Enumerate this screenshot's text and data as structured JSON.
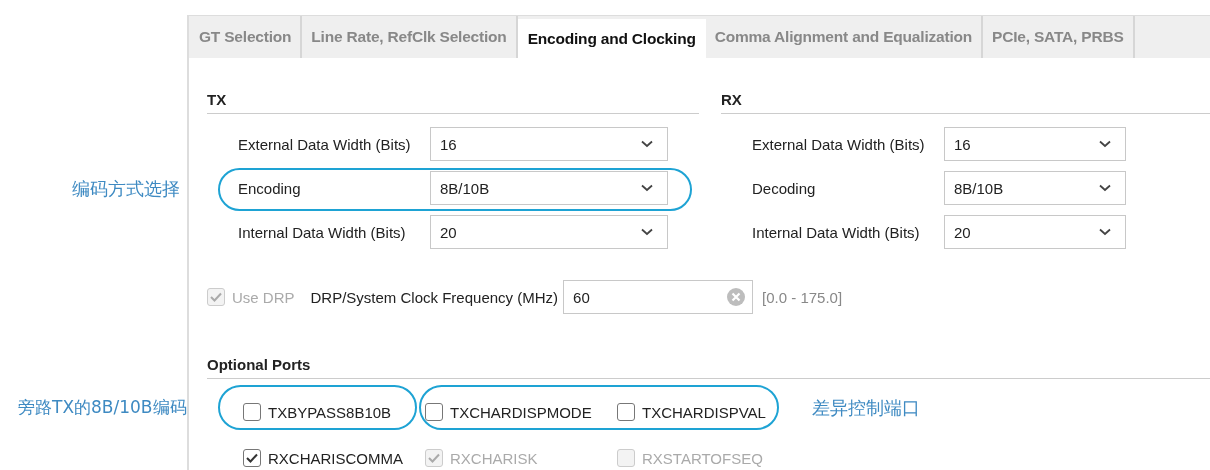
{
  "tabs": [
    {
      "label": "GT Selection",
      "selected": false
    },
    {
      "label": "Line Rate, RefClk Selection",
      "selected": false
    },
    {
      "label": "Encoding and Clocking",
      "selected": true
    },
    {
      "label": "Comma Alignment and Equalization",
      "selected": false
    },
    {
      "label": "PCIe, SATA, PRBS",
      "selected": false
    }
  ],
  "sections": [
    {
      "title": "TX",
      "fields": [
        {
          "label": "External Data Width (Bits)",
          "value": "16"
        },
        {
          "label": "Encoding",
          "value": "8B/10B"
        },
        {
          "label": "Internal Data Width (Bits)",
          "value": "20"
        }
      ]
    },
    {
      "title": "RX",
      "fields": [
        {
          "label": "External Data Width (Bits)",
          "value": "16"
        },
        {
          "label": "Decoding",
          "value": "8B/10B"
        },
        {
          "label": "Internal Data Width (Bits)",
          "value": "20"
        }
      ]
    }
  ],
  "drp": {
    "use_drp": {
      "label": "Use DRP",
      "checked": true,
      "disabled": true
    },
    "frequency_label": "DRP/System Clock Frequency (MHz)",
    "frequency_value": "60",
    "range": "[0.0 - 175.0]"
  },
  "optional_ports": {
    "title": "Optional Ports",
    "rows": [
      [
        {
          "label": "TXBYPASS8B10B",
          "checked": false,
          "disabled": false
        },
        {
          "label": "TXCHARDISPMODE",
          "checked": false,
          "disabled": false
        },
        {
          "label": "TXCHARDISPVAL",
          "checked": false,
          "disabled": false
        }
      ],
      [
        {
          "label": "RXCHARISCOMMA",
          "checked": true,
          "disabled": false
        },
        {
          "label": "RXCHARISK",
          "checked": true,
          "disabled": true
        },
        {
          "label": "RXSTARTOFSEQ",
          "checked": false,
          "disabled": true
        }
      ]
    ]
  },
  "annotations": [
    {
      "text": "编码方式选择"
    },
    {
      "text": "旁路TX的8B/10B编码"
    },
    {
      "text": "差异控制端口"
    }
  ]
}
